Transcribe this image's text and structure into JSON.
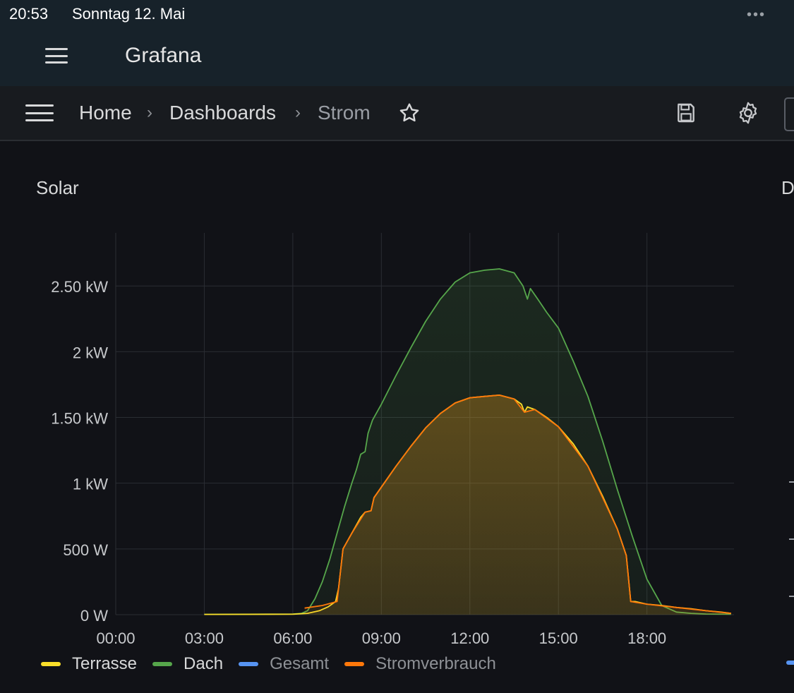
{
  "status": {
    "time": "20:53",
    "date": "Sonntag 12. Mai",
    "more": "•••"
  },
  "app": {
    "title": "Grafana"
  },
  "breadcrumb": {
    "home": "Home",
    "dashboards": "Dashboards",
    "current": "Strom",
    "separator": "›"
  },
  "toolbar": {
    "star_icon": "star-icon",
    "save_icon": "save-icon",
    "settings_icon": "gear-icon"
  },
  "panel": {
    "title": "Solar",
    "second_panel_title_partial": "D"
  },
  "colors": {
    "terrasse": "#fade2a",
    "dach": "#56a64b",
    "gesamt": "#5794f2",
    "stromverbrauch": "#ff780a",
    "grid": "#2a2d33",
    "tick_text": "#c7c9cc"
  },
  "chart_data": {
    "type": "area",
    "x_unit": "hours",
    "xlim": [
      0,
      20.95
    ],
    "ylim": [
      0,
      2.85
    ],
    "y_ticks": [
      {
        "v": 0,
        "label": "0 W"
      },
      {
        "v": 0.5,
        "label": "500 W"
      },
      {
        "v": 1,
        "label": "1 kW"
      },
      {
        "v": 1.5,
        "label": "1.50 kW"
      },
      {
        "v": 2,
        "label": "2 kW"
      },
      {
        "v": 2.5,
        "label": "2.50 kW"
      }
    ],
    "x_ticks": [
      {
        "v": 0,
        "label": "00:00"
      },
      {
        "v": 3,
        "label": "03:00"
      },
      {
        "v": 6,
        "label": "06:00"
      },
      {
        "v": 9,
        "label": "09:00"
      },
      {
        "v": 12,
        "label": "12:00"
      },
      {
        "v": 15,
        "label": "15:00"
      },
      {
        "v": 18,
        "label": "18:00"
      }
    ],
    "series": [
      {
        "name": "Dach",
        "color": "#56a64b",
        "points": [
          [
            3,
            0.002
          ],
          [
            6,
            0.005
          ],
          [
            6.3,
            0.01
          ],
          [
            6.5,
            0.03
          ],
          [
            6.75,
            0.12
          ],
          [
            7,
            0.25
          ],
          [
            7.25,
            0.42
          ],
          [
            7.5,
            0.62
          ],
          [
            7.75,
            0.82
          ],
          [
            8,
            1
          ],
          [
            8.15,
            1.1
          ],
          [
            8.3,
            1.22
          ],
          [
            8.45,
            1.24
          ],
          [
            8.55,
            1.38
          ],
          [
            8.7,
            1.48
          ],
          [
            9,
            1.6
          ],
          [
            9.5,
            1.82
          ],
          [
            10,
            2.03
          ],
          [
            10.5,
            2.23
          ],
          [
            11,
            2.4
          ],
          [
            11.5,
            2.53
          ],
          [
            12,
            2.6
          ],
          [
            12.5,
            2.62
          ],
          [
            13,
            2.63
          ],
          [
            13.5,
            2.6
          ],
          [
            13.8,
            2.5
          ],
          [
            13.95,
            2.4
          ],
          [
            14.05,
            2.48
          ],
          [
            14.3,
            2.4
          ],
          [
            14.6,
            2.3
          ],
          [
            15,
            2.18
          ],
          [
            15.5,
            1.93
          ],
          [
            16,
            1.66
          ],
          [
            16.5,
            1.32
          ],
          [
            17,
            0.95
          ],
          [
            17.5,
            0.6
          ],
          [
            18,
            0.27
          ],
          [
            18.5,
            0.07
          ],
          [
            19,
            0.02
          ],
          [
            19.5,
            0.01
          ],
          [
            20,
            0.005
          ],
          [
            20.85,
            0.003
          ]
        ]
      },
      {
        "name": "Terrasse",
        "color": "#fade2a",
        "points": [
          [
            3,
            0.002
          ],
          [
            6,
            0.003
          ],
          [
            6.5,
            0.01
          ],
          [
            6.9,
            0.03
          ],
          [
            7.2,
            0.06
          ],
          [
            7.45,
            0.1
          ],
          [
            7.55,
            0.2
          ],
          [
            7.7,
            0.5
          ],
          [
            8,
            0.62
          ],
          [
            8.3,
            0.74
          ],
          [
            8.45,
            0.78
          ],
          [
            8.65,
            0.79
          ],
          [
            8.75,
            0.89
          ],
          [
            9,
            0.97
          ],
          [
            9.5,
            1.13
          ],
          [
            10,
            1.28
          ],
          [
            10.5,
            1.42
          ],
          [
            11,
            1.53
          ],
          [
            11.5,
            1.61
          ],
          [
            12,
            1.65
          ],
          [
            12.5,
            1.66
          ],
          [
            13,
            1.67
          ],
          [
            13.5,
            1.64
          ],
          [
            13.75,
            1.6
          ],
          [
            13.85,
            1.54
          ],
          [
            13.95,
            1.58
          ],
          [
            14.2,
            1.56
          ],
          [
            14.6,
            1.5
          ],
          [
            15,
            1.43
          ],
          [
            15.5,
            1.3
          ],
          [
            16,
            1.13
          ],
          [
            16.5,
            0.9
          ],
          [
            17,
            0.65
          ],
          [
            17.3,
            0.45
          ],
          [
            17.45,
            0.1
          ],
          [
            17.6,
            0.1
          ],
          [
            18,
            0.08
          ],
          [
            18.5,
            0.07
          ],
          [
            19,
            0.055
          ],
          [
            19.5,
            0.045
          ],
          [
            20,
            0.03
          ],
          [
            20.5,
            0.02
          ],
          [
            20.85,
            0.01
          ]
        ]
      },
      {
        "name": "Stromverbrauch",
        "color": "#ff780a",
        "points": [
          [
            6.4,
            0.05
          ],
          [
            7,
            0.07
          ],
          [
            7.5,
            0.1
          ],
          [
            7.7,
            0.5
          ],
          [
            8,
            0.62
          ],
          [
            8.45,
            0.78
          ],
          [
            8.65,
            0.79
          ],
          [
            8.75,
            0.89
          ],
          [
            9,
            0.97
          ],
          [
            9.5,
            1.13
          ],
          [
            10,
            1.28
          ],
          [
            10.5,
            1.42
          ],
          [
            11,
            1.53
          ],
          [
            11.5,
            1.61
          ],
          [
            12,
            1.65
          ],
          [
            12.5,
            1.66
          ],
          [
            13,
            1.67
          ],
          [
            13.5,
            1.64
          ],
          [
            13.85,
            1.54
          ],
          [
            14.2,
            1.56
          ],
          [
            15,
            1.43
          ],
          [
            16,
            1.13
          ],
          [
            17,
            0.65
          ],
          [
            17.3,
            0.45
          ],
          [
            17.45,
            0.1
          ],
          [
            18,
            0.08
          ],
          [
            19,
            0.055
          ],
          [
            20,
            0.03
          ],
          [
            20.85,
            0.01
          ]
        ]
      }
    ],
    "legend": [
      {
        "name": "Terrasse",
        "color": "#fade2a",
        "dimmed": false
      },
      {
        "name": "Dach",
        "color": "#56a64b",
        "dimmed": false
      },
      {
        "name": "Gesamt",
        "color": "#5794f2",
        "dimmed": true
      },
      {
        "name": "Stromverbrauch",
        "color": "#ff780a",
        "dimmed": true
      }
    ]
  }
}
